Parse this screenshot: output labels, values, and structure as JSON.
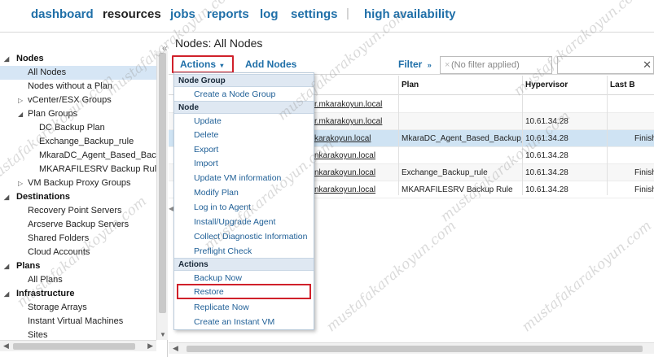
{
  "nav": {
    "items": [
      "dashboard",
      "resources",
      "jobs",
      "reports",
      "log",
      "settings"
    ],
    "separator": "|",
    "ha": "high availability"
  },
  "page_title": "Nodes: All Nodes",
  "toolbar": {
    "actions": "Actions",
    "add_nodes": "Add Nodes",
    "filter": "Filter",
    "filter_placeholder": "(No filter applied)"
  },
  "tree": {
    "sections": {
      "nodes": "Nodes",
      "destinations": "Destinations",
      "plans": "Plans",
      "infrastructure": "Infrastructure"
    },
    "items": {
      "all_nodes": "All Nodes",
      "nodes_without_plan": "Nodes without a Plan",
      "vcenter": "vCenter/ESX Groups",
      "plan_groups": "Plan Groups",
      "dc_backup_plan": "DC Backup Plan",
      "exchange_backup_rule": "Exchange_Backup_rule",
      "mkara_dc_agent": "MkaraDC_Agent_Based_Backup_",
      "mkarafilesrv": "MKARAFILESRV Backup Rule",
      "vm_backup_proxy": "VM Backup Proxy Groups",
      "recovery_point_servers": "Recovery Point Servers",
      "arcserve_backup_servers": "Arcserve Backup Servers",
      "shared_folders": "Shared Folders",
      "cloud_accounts": "Cloud Accounts",
      "all_plans": "All Plans",
      "storage_arrays": "Storage Arrays",
      "instant_vms": "Instant Virtual Machines",
      "sites": "Sites"
    }
  },
  "table": {
    "headers": {
      "plan": "Plan",
      "hypervisor": "Hypervisor",
      "last_backup": "Last B"
    },
    "rows": [
      {
        "name": "r.mkarakoyun.local",
        "plan": "",
        "hypervisor": "",
        "last": ""
      },
      {
        "name": "r.mkarakoyun.local",
        "plan": "",
        "hypervisor": "10.61.34.28",
        "last": ""
      },
      {
        "name": "karakoyun.local",
        "plan": "MkaraDC_Agent_Based_Backup_",
        "hypervisor": "10.61.34.28",
        "last": "Finish"
      },
      {
        "name": "nkarakoyun.local",
        "plan": "",
        "hypervisor": "10.61.34.28",
        "last": ""
      },
      {
        "name": "nkarakoyun.local",
        "plan": "Exchange_Backup_rule",
        "hypervisor": "10.61.34.28",
        "last": "Finish"
      },
      {
        "name": "nkarakoyun.local",
        "plan": "MKARAFILESRV Backup Rule",
        "hypervisor": "10.61.34.28",
        "last": "Finish"
      }
    ]
  },
  "menu": {
    "groups": {
      "node_group": "Node Group",
      "node": "Node",
      "actions": "Actions"
    },
    "items": {
      "create_node_group": "Create a Node Group",
      "update": "Update",
      "delete": "Delete",
      "export": "Export",
      "import": "Import",
      "update_vm_info": "Update VM information",
      "modify_plan": "Modify Plan",
      "log_in_agent": "Log in to Agent",
      "install_upgrade_agent": "Install/Upgrade Agent",
      "collect_diag": "Collect Diagnostic Information",
      "preflight_check": "Preflight Check",
      "backup_now": "Backup Now",
      "restore": "Restore",
      "replicate_now": "Replicate Now",
      "create_instant_vm": "Create an Instant VM"
    }
  },
  "watermark": "mustafakarakoyun.com"
}
